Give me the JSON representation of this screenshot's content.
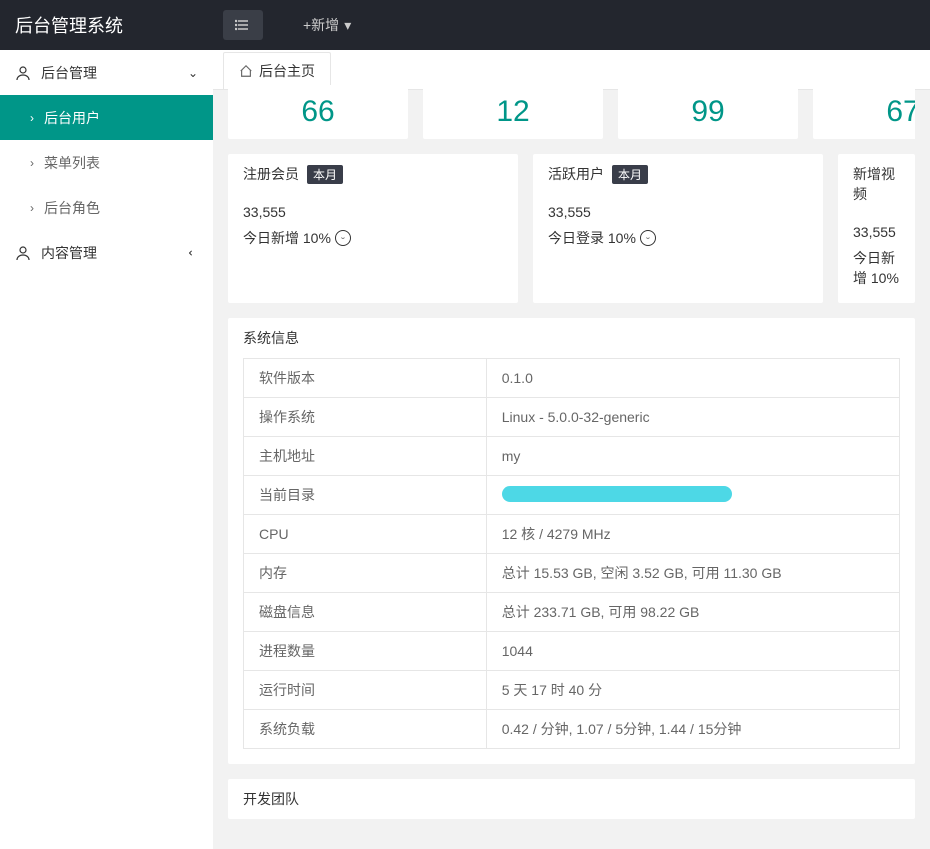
{
  "header": {
    "logo": "后台管理系统",
    "new_action": "+新增"
  },
  "sidebar": {
    "sections": [
      {
        "label": "后台管理",
        "expanded": true,
        "items": [
          {
            "label": "后台用户",
            "active": true
          },
          {
            "label": "菜单列表",
            "active": false
          },
          {
            "label": "后台角色",
            "active": false
          }
        ]
      },
      {
        "label": "内容管理",
        "expanded": false,
        "items": []
      }
    ]
  },
  "tabs": [
    {
      "label": "后台主页"
    }
  ],
  "top_stats": [
    {
      "value": "66"
    },
    {
      "value": "12"
    },
    {
      "value": "99"
    },
    {
      "value": "67"
    }
  ],
  "cards": [
    {
      "title": "注册会员",
      "badge": "本月",
      "value": "33,555",
      "sub": "今日新增 10%"
    },
    {
      "title": "活跃用户",
      "badge": "本月",
      "value": "33,555",
      "sub": "今日登录 10%"
    },
    {
      "title": "新增视频",
      "badge": "",
      "value": "33,555",
      "sub": "今日新增 10%"
    }
  ],
  "sysinfo": {
    "title": "系统信息",
    "rows": [
      {
        "k": "软件版本",
        "v": "0.1.0"
      },
      {
        "k": "操作系统",
        "v": "Linux - 5.0.0-32-generic"
      },
      {
        "k": "主机地址",
        "v": "my"
      },
      {
        "k": "当前目录",
        "v": ""
      },
      {
        "k": "CPU",
        "v": "12 核 / 4279 MHz"
      },
      {
        "k": "内存",
        "v": "总计 15.53 GB, 空闲 3.52 GB, 可用 11.30 GB"
      },
      {
        "k": "磁盘信息",
        "v": "总计 233.71 GB, 可用 98.22 GB"
      },
      {
        "k": "进程数量",
        "v": "1044"
      },
      {
        "k": "运行时间",
        "v": "5 天 17 时 40 分"
      },
      {
        "k": "系统负载",
        "v": "0.42 / 分钟, 1.07 / 5分钟, 1.44 / 15分钟"
      }
    ]
  },
  "team": {
    "title": "开发团队"
  }
}
